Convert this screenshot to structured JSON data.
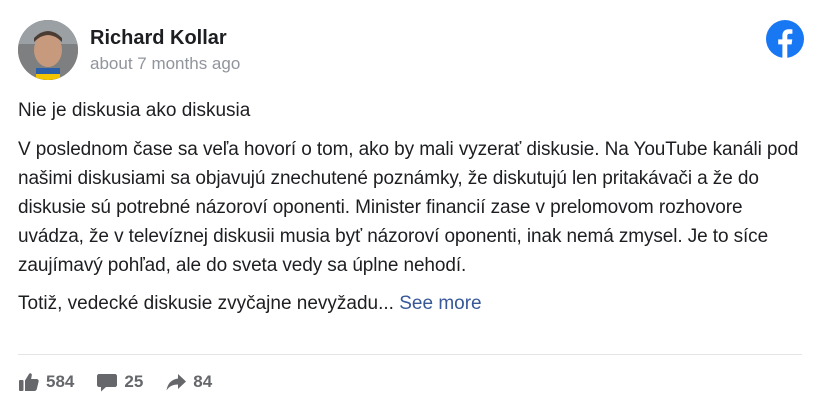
{
  "author": {
    "name": "Richard Kollar",
    "time": "about 7 months ago"
  },
  "post": {
    "title": "Nie je diskusia ako diskusia",
    "paragraph": "V poslednom čase sa veľa hovorí o tom, ako by mali vyzerať diskusie. Na YouTube kanáli pod našimi diskusiami sa objavujú znechutené poznámky, že diskutujú len pritakávači a že do diskusie sú potrebné názoroví oponenti. Minister financií zase v prelomovom rozhovore uvádza, že v televíznej diskusii musia byť názoroví oponenti, inak nemá zmysel. Je to síce zaujímavý pohľad, ale do sveta vedy sa úplne nehodí.",
    "teaser": "Totiž, vedecké diskusie zvyčajne nevyžadu...",
    "see_more": "See more"
  },
  "stats": {
    "likes": "584",
    "comments": "25",
    "shares": "84"
  },
  "icons": {
    "brand": "facebook-icon",
    "like": "thumbs-up-icon",
    "comment": "comment-bubble-icon",
    "share": "share-arrow-icon"
  },
  "colors": {
    "facebook_blue": "#1877f2",
    "link": "#385898",
    "muted": "#90949c",
    "stat": "#65676b"
  }
}
